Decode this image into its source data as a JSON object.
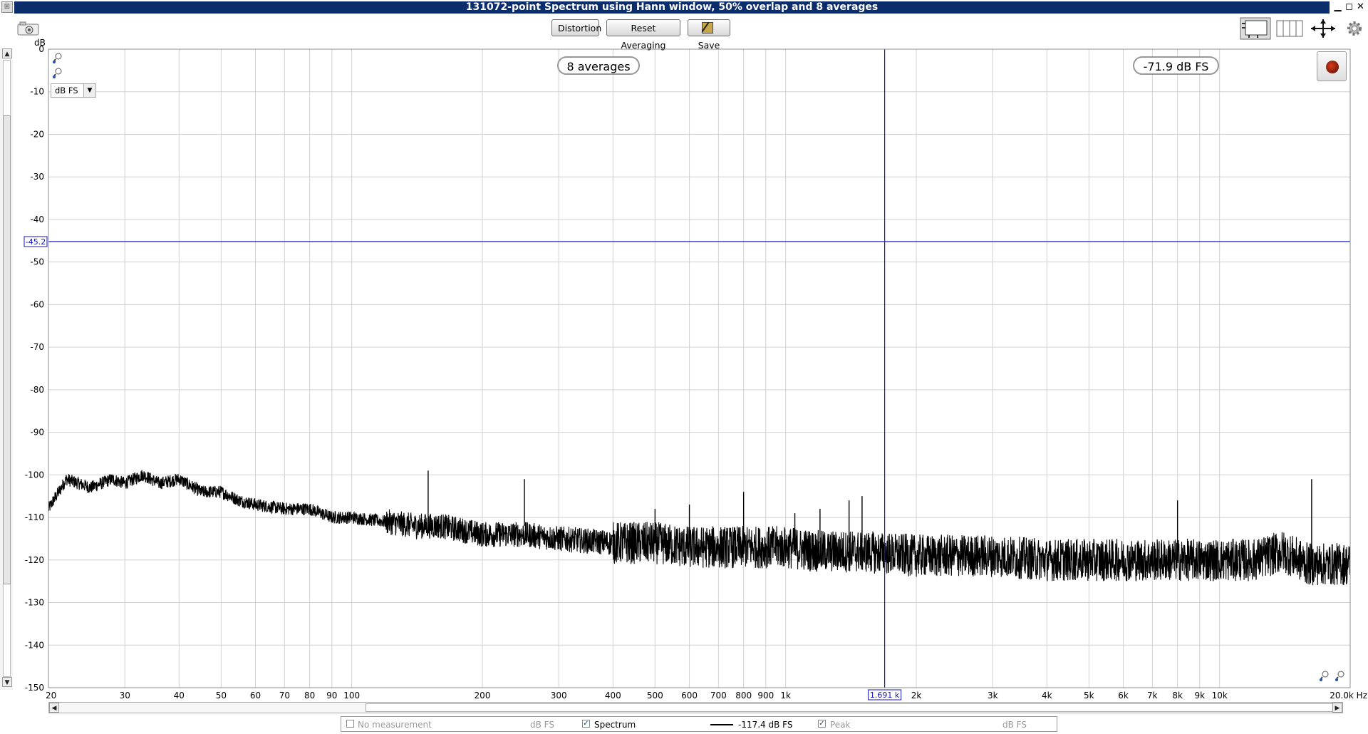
{
  "window": {
    "title": "131072-point Spectrum using Hann window, 50% overlap and 8 averages",
    "controls": {
      "minimize": "▁",
      "maximize": "◻",
      "close": "✕"
    }
  },
  "toolbar": {
    "distortion_label": "Distortion",
    "reset_label": "Reset Averaging",
    "save_label": "Save",
    "icons": [
      "camera-icon",
      "graph-layout-icon",
      "columns-icon",
      "axes-limits-icon",
      "gear-icon"
    ]
  },
  "readouts": {
    "averages": "8 averages",
    "level": "-71.9 dB FS"
  },
  "unit_selector": {
    "value": "dB FS"
  },
  "cursor": {
    "x_readout": "1.691 k",
    "y_readout": "-45.2",
    "freq_hz": 1691,
    "level_db": -45.2
  },
  "legend": {
    "items": [
      {
        "label": "No measurement",
        "unit": "dB FS",
        "checked": false
      },
      {
        "label": "Spectrum",
        "value": "-117.4 dB FS",
        "checked": true
      },
      {
        "label": "Peak",
        "unit": "dB FS",
        "checked": true
      }
    ]
  },
  "chart_data": {
    "type": "line",
    "title": "",
    "ylabel": "dB",
    "xlabel": "Hz",
    "x_scale": "log",
    "xlim": [
      20,
      20000
    ],
    "ylim": [
      -150,
      0
    ],
    "grid": true,
    "y_ticks": [
      "0",
      "-10",
      "-20",
      "-30",
      "-40",
      "-50",
      "-60",
      "-70",
      "-80",
      "-90",
      "-100",
      "-110",
      "-120",
      "-130",
      "-140",
      "-150"
    ],
    "x_ticks": [
      {
        "v": 20,
        "label": "20"
      },
      {
        "v": 30,
        "label": "30"
      },
      {
        "v": 40,
        "label": "40"
      },
      {
        "v": 50,
        "label": "50"
      },
      {
        "v": 60,
        "label": "60"
      },
      {
        "v": 70,
        "label": "70"
      },
      {
        "v": 80,
        "label": "80"
      },
      {
        "v": 90,
        "label": "90"
      },
      {
        "v": 100,
        "label": "100"
      },
      {
        "v": 200,
        "label": "200"
      },
      {
        "v": 300,
        "label": "300"
      },
      {
        "v": 400,
        "label": "400"
      },
      {
        "v": 500,
        "label": "500"
      },
      {
        "v": 600,
        "label": "600"
      },
      {
        "v": 700,
        "label": "700"
      },
      {
        "v": 800,
        "label": "800"
      },
      {
        "v": 900,
        "label": "900"
      },
      {
        "v": 1000,
        "label": "1k"
      },
      {
        "v": 2000,
        "label": "2k"
      },
      {
        "v": 3000,
        "label": "3k"
      },
      {
        "v": 4000,
        "label": "4k"
      },
      {
        "v": 5000,
        "label": "5k"
      },
      {
        "v": 6000,
        "label": "6k"
      },
      {
        "v": 7000,
        "label": "7k"
      },
      {
        "v": 8000,
        "label": "8k"
      },
      {
        "v": 9000,
        "label": "9k"
      },
      {
        "v": 10000,
        "label": "10k"
      },
      {
        "v": 20000,
        "label": "20.0k Hz"
      }
    ],
    "series": [
      {
        "color": "#000000",
        "x": [
          20,
          22,
          25,
          28,
          30,
          33,
          36,
          40,
          45,
          50,
          55,
          60,
          70,
          80,
          90,
          100,
          120,
          140,
          160,
          180,
          200,
          250,
          300,
          400,
          500,
          600,
          700,
          800,
          900,
          1000,
          1200,
          1500,
          2000,
          2500,
          3000,
          4000,
          5000,
          6000,
          7000,
          8000,
          9000,
          10000,
          12000,
          14000,
          16000,
          18000,
          20000
        ],
        "values": [
          -108,
          -101,
          -103,
          -101,
          -102,
          -100,
          -102,
          -101,
          -104,
          -104,
          -106,
          -107,
          -108,
          -108,
          -110,
          -110,
          -111,
          -112,
          -112,
          -113,
          -114,
          -114,
          -115,
          -116,
          -116,
          -117,
          -117,
          -117,
          -117,
          -117,
          -118,
          -118,
          -119,
          -119,
          -119,
          -120,
          -120,
          -120,
          -120,
          -120,
          -120,
          -120,
          -120,
          -118,
          -121,
          -121,
          -121
        ],
        "noise_band_db": 5
      }
    ],
    "peaks": [
      {
        "x": 150,
        "y": -99
      },
      {
        "x": 250,
        "y": -101
      },
      {
        "x": 1500,
        "y": -105
      },
      {
        "x": 800,
        "y": -104
      },
      {
        "x": 600,
        "y": -107
      },
      {
        "x": 500,
        "y": -108
      },
      {
        "x": 1050,
        "y": -109
      },
      {
        "x": 1200,
        "y": -108
      },
      {
        "x": 1400,
        "y": -106
      },
      {
        "x": 8000,
        "y": -106
      },
      {
        "x": 16300,
        "y": -101
      }
    ]
  }
}
